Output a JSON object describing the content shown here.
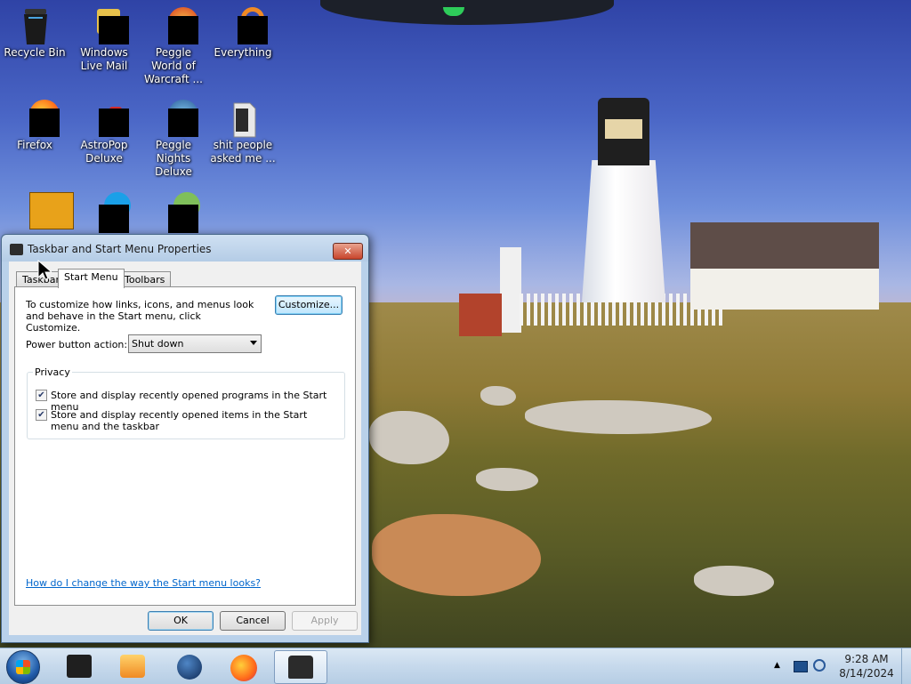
{
  "desktop": {
    "icons": [
      {
        "label": "Recycle Bin",
        "icon": "recycle-bin-icon"
      },
      {
        "label": "Windows Live Mail",
        "icon": "mail-icon"
      },
      {
        "label": "Peggle World of Warcraft ...",
        "icon": "peggle-icon"
      },
      {
        "label": "Everything",
        "icon": "search-icon"
      },
      {
        "label": "Firefox",
        "icon": "firefox-icon"
      },
      {
        "label": "AstroPop Deluxe",
        "icon": "astropop-icon"
      },
      {
        "label": "Peggle Nights Deluxe",
        "icon": "peggle-nights-icon"
      },
      {
        "label": "shit people asked me ...",
        "icon": "folder-icon"
      },
      {
        "label": "",
        "icon": "app-icon"
      },
      {
        "label": "",
        "icon": "app-icon"
      },
      {
        "label": "",
        "icon": "app-icon"
      }
    ]
  },
  "dialog": {
    "title": "Taskbar and Start Menu Properties",
    "close_label": "✕",
    "tabs": [
      {
        "label": "Taskbar",
        "active": false
      },
      {
        "label": "Start Menu",
        "active": true
      },
      {
        "label": "Toolbars",
        "active": false
      }
    ],
    "description": "To customize how links, icons, and menus look and behave in the Start menu, click Customize.",
    "customize_label": "Customize...",
    "power_label": "Power button action:",
    "power_value": "Shut down",
    "privacy_legend": "Privacy",
    "checkboxes": [
      {
        "label": "Store and display recently opened programs in the Start menu",
        "checked": true
      },
      {
        "label": "Store and display recently opened items in the Start menu and the taskbar",
        "checked": true
      }
    ],
    "help_link": "How do I change the way the Start menu looks?",
    "buttons": {
      "ok": "OK",
      "cancel": "Cancel",
      "apply": "Apply"
    }
  },
  "taskbar": {
    "pinned": [
      {
        "icon": "app-icon",
        "active": false
      },
      {
        "icon": "media-player-icon",
        "active": false
      },
      {
        "icon": "globe-icon",
        "active": false
      },
      {
        "icon": "firefox-icon",
        "active": false
      },
      {
        "icon": "taskbar-properties-icon",
        "active": true
      }
    ],
    "tray": {
      "time": "9:28 AM",
      "date": "8/14/2024",
      "icons": [
        "show-hidden-icons-icon",
        "action-center-icon",
        "network-icon"
      ]
    }
  },
  "colors": {
    "accent": "#3c7fb1",
    "link": "#0066cc",
    "close_button": "#c8452c"
  }
}
